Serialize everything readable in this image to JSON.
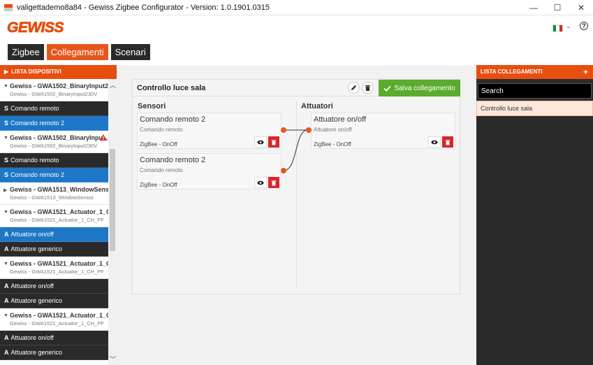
{
  "window": {
    "title": "valigettademo8a84 - Gewiss Zigbee Configurator - Version: 1.0.1901.0315",
    "controls": {
      "minimize": "—",
      "maximize": "☐",
      "close": "✕"
    }
  },
  "brand": {
    "logo_text": "GEWISS",
    "logo_color": "#e84e10",
    "language_flag": [
      "#009246",
      "#ffffff",
      "#ce2b37"
    ],
    "help_label": "?"
  },
  "tabs": [
    {
      "label": "Zigbee",
      "active": false
    },
    {
      "label": "Collegamenti",
      "active": true
    },
    {
      "label": "Scenari",
      "active": false
    }
  ],
  "left_panel": {
    "title": "LISTA DISPOSITIVI",
    "entries": [
      {
        "kind": "device",
        "name": "Gewiss - GWA1502_BinaryInput2...",
        "model": "Gewiss - GWA1502_BinaryInput230V",
        "expanded": true,
        "warning": false
      },
      {
        "kind": "item",
        "prefix": "S",
        "label": "Comando remoto",
        "selected": false
      },
      {
        "kind": "item",
        "prefix": "S",
        "label": "Comando remoto 2",
        "selected": true
      },
      {
        "kind": "device",
        "name": "Gewiss - GWA1502_BinaryInpu...",
        "model": "Gewiss - GWA1502_BinaryInput230V",
        "expanded": true,
        "warning": true
      },
      {
        "kind": "item",
        "prefix": "S",
        "label": "Comando remoto",
        "selected": false
      },
      {
        "kind": "item",
        "prefix": "S",
        "label": "Comando remoto 2",
        "selected": true
      },
      {
        "kind": "device",
        "name": "Gewiss - GWA1513_WindowSens...",
        "model": "Gewiss - GWA1513_WindowSensor",
        "expanded": false,
        "warning": false
      },
      {
        "kind": "device",
        "name": "Gewiss - GWA1521_Actuator_1_C...",
        "model": "Gewiss - GWA1521_Actuator_1_CH_PF",
        "expanded": true,
        "warning": false
      },
      {
        "kind": "item",
        "prefix": "A",
        "label": "Attuatore on/off",
        "selected": true
      },
      {
        "kind": "item",
        "prefix": "A",
        "label": "Attuatore generico",
        "selected": false
      },
      {
        "kind": "device",
        "name": "Gewiss - GWA1521_Actuator_1_C...",
        "model": "Gewiss - GWA1521_Actuator_1_CH_PF",
        "expanded": true,
        "warning": false
      },
      {
        "kind": "item",
        "prefix": "A",
        "label": "Attuatore on/off",
        "selected": false
      },
      {
        "kind": "item",
        "prefix": "A",
        "label": "Attuatore generico",
        "selected": false
      },
      {
        "kind": "device",
        "name": "Gewiss - GWA1521_Actuator_1_C...",
        "model": "Gewiss - GWA1521_Actuator_1_CH_PF",
        "expanded": true,
        "warning": false
      },
      {
        "kind": "item",
        "prefix": "A",
        "label": "Attuatore on/off",
        "selected": false
      },
      {
        "kind": "item",
        "prefix": "A",
        "label": "Attuatore generico",
        "selected": false
      }
    ]
  },
  "link_editor": {
    "title": "Controllo luce sala",
    "save_label": "Salva collegamento",
    "sensors_title": "Sensori",
    "actuators_title": "Attuatori",
    "sensors": [
      {
        "title": "Comando remoto 2",
        "subtitle": "Comando remoto",
        "protocol": "ZigBee - OnOff"
      },
      {
        "title": "Comando remoto 2",
        "subtitle": "Comando remoto",
        "protocol": "ZigBee - OnOff"
      }
    ],
    "actuators": [
      {
        "title": "Attuatore on/off",
        "subtitle": "Attuatore on/off",
        "protocol": "ZigBee - OnOff"
      }
    ],
    "accent_color": "#e9561c",
    "save_color": "#5bab2c",
    "delete_color": "#d9262b"
  },
  "right_panel": {
    "title": "LISTA COLLEGAMENTI",
    "add_label": "+",
    "search_placeholder": "Search",
    "links": [
      "Controllo luce sala"
    ]
  }
}
